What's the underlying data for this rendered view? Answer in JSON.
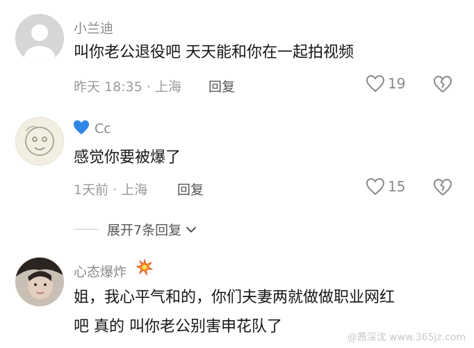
{
  "comments": [
    {
      "name": "小兰迪",
      "text_lines": [
        "叫你老公退役吧 天天能和你在一起拍视频"
      ],
      "meta": "昨天 18:35 · 上海",
      "reply_label": "回复",
      "likes": "19"
    },
    {
      "name": "Cc",
      "name_badge": "💙",
      "text_lines": [
        "感觉你要被爆了"
      ],
      "meta": "1天前 · 上海",
      "reply_label": "回复",
      "likes": "15"
    },
    {
      "name": "心态爆炸",
      "name_badge": "💥",
      "text_lines": [
        "姐，我心平气和的，你们夫妻两就做做职业网红",
        "吧 真的 叫你老公别害申花队了"
      ]
    }
  ],
  "expand_replies": "展开7条回复",
  "watermark": "@茜深沈  www.365jz.com",
  "colors": {
    "name": "#8a8a8a",
    "meta": "#9a9a9a",
    "text": "#161616",
    "icon": "#888888"
  }
}
